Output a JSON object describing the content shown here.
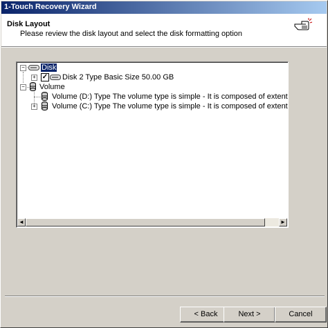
{
  "window": {
    "title": "1-Touch Recovery Wizard"
  },
  "header": {
    "title": "Disk Layout",
    "subtitle": "Please review the disk layout and select the disk formatting option",
    "icon": "pointing-hand-icon"
  },
  "tree": {
    "disk_group": {
      "label": "Disk",
      "expander": "−"
    },
    "disk_item": {
      "label": "Disk 2 Type Basic Size 50.00 GB",
      "checked": true,
      "check_mark": "✓",
      "expander": "+"
    },
    "volume_group": {
      "label": "Volume",
      "expander": "−"
    },
    "volumes": [
      {
        "label": "Volume (D:) Type The volume type is simple - It is composed of extents from exactly",
        "expander": ""
      },
      {
        "label": "Volume (C:) Type The volume type is simple - It is composed of extents from exactly",
        "expander": "+"
      }
    ]
  },
  "scrollbar": {
    "left_arrow": "◄",
    "right_arrow": "►"
  },
  "buttons": {
    "back": "< Back",
    "next": "Next >",
    "cancel": "Cancel"
  }
}
